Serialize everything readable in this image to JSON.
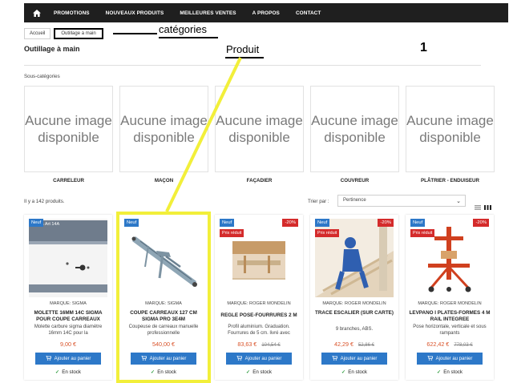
{
  "nav": {
    "items": [
      "PROMOTIONS",
      "NOUVEAUX PRODUITS",
      "MEILLEURES VENTES",
      "A PROPOS",
      "CONTACT"
    ]
  },
  "breadcrumb": [
    "Accueil",
    "Outillage à main"
  ],
  "annotations": {
    "categories": "catégories",
    "produit": "Produit",
    "number": "1",
    "highlight_color": "#f2ef3a",
    "line_color": "#000000"
  },
  "page": {
    "title": "Outillage à main",
    "subcategories_title": "Sous-catégories",
    "product_count": "Il y a 142 produits.",
    "sort_label": "Trier par :",
    "sort_value": "Pertinence"
  },
  "subcategories": [
    {
      "image_text": "Aucune image disponible",
      "label": "CARRELEUR"
    },
    {
      "image_text": "Aucune image disponible",
      "label": "MAÇON"
    },
    {
      "image_text": "Aucune image disponible",
      "label": "FAÇADIER"
    },
    {
      "image_text": "Aucune image disponible",
      "label": "COUVREUR"
    },
    {
      "image_text": "Aucune image disponible",
      "label": "PLÂTRIER - ENDUISEUR"
    }
  ],
  "products": [
    {
      "badge_new": "Neuf",
      "badge_discount": "",
      "badge_reduced": "",
      "image_caption": "Sigma Art 14A",
      "brand_label": "MARQUE:",
      "brand": "SIGMA",
      "name": "MOLETTE 16MM 14C SIGMA POUR COUPE CARREAUX",
      "description": "Molette carbure sigma diamètre 16mm 14C pour la",
      "price": "9,00 €",
      "old_price": "",
      "cart_label": "Ajouter au panier",
      "stock": "En stock"
    },
    {
      "badge_new": "Neuf",
      "badge_discount": "",
      "badge_reduced": "",
      "image_caption": "",
      "brand_label": "MARQUE:",
      "brand": "SIGMA",
      "name": "COUPE CARREAUX 127 CM SIGMA PRO 3E4M",
      "description": "Coupeuse de carreaux manuelle professionnelle",
      "price": "540,00 €",
      "old_price": "",
      "cart_label": "Ajouter au panier",
      "stock": "En stock"
    },
    {
      "badge_new": "Neuf",
      "badge_discount": "-20%",
      "badge_reduced": "Prix réduit",
      "image_caption": "",
      "brand_label": "MARQUE:",
      "brand": "ROGER MONDELIN",
      "name": "REGLE POSE-FOURRURES 2 M",
      "description": "Profil aluminium. Graduation. Fourrures de 5 cm. livré avec",
      "price": "83,63 €",
      "old_price": "104,54 €",
      "cart_label": "Ajouter au panier",
      "stock": "En stock"
    },
    {
      "badge_new": "Neuf",
      "badge_discount": "-20%",
      "badge_reduced": "Prix réduit",
      "image_caption": "",
      "brand_label": "MARQUE:",
      "brand": "ROGER MONDELIN",
      "name": "TRACE ESCALIER (SUR CARTE)",
      "description": "9 branches, ABS.",
      "price": "42,29 €",
      "old_price": "52,86 €",
      "cart_label": "Ajouter au panier",
      "stock": "En stock"
    },
    {
      "badge_new": "Neuf",
      "badge_discount": "-20%",
      "badge_reduced": "Prix réduit",
      "image_caption": "",
      "brand_label": "MARQUE:",
      "brand": "ROGER MONDELIN",
      "name": "LEVPANO I PLATES-FORMES 4 M RAIL INTEGREE",
      "description": "Pose horizontale, verticale et sous rampants",
      "price": "622,42 €",
      "old_price": "778,03 €",
      "cart_label": "Ajouter au panier",
      "stock": "En stock"
    }
  ]
}
